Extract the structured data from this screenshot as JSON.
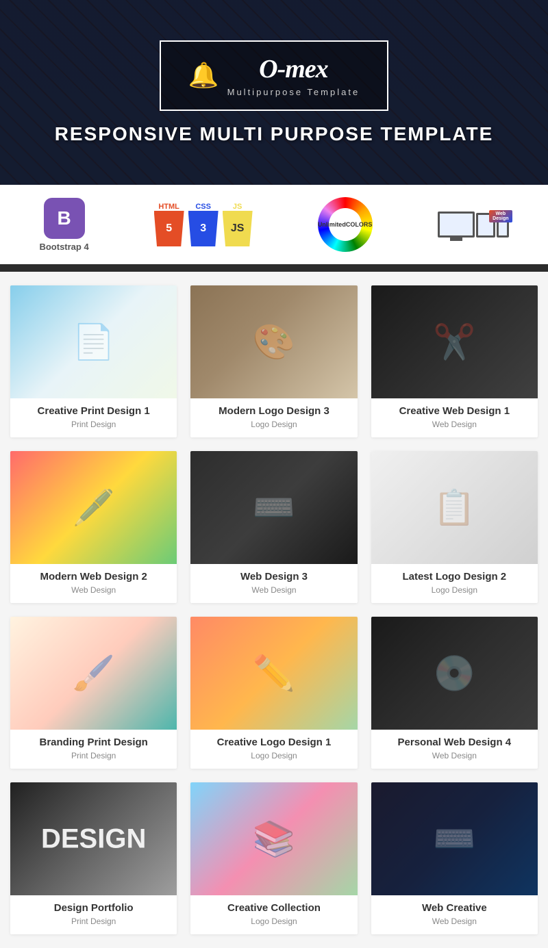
{
  "hero": {
    "logo_name": "O-mex",
    "logo_sub": "Multipurpose Template",
    "tagline": "RESPONSIVE MULTI PURPOSE TEMPLATE"
  },
  "tech_strip": {
    "bootstrap_label": "Bootstrap 4",
    "html_label": "HTML",
    "css_label": "CSS",
    "js_label": "JS",
    "colors_label": "Unlimited\nCOLORS",
    "colors_line1": "Unlimited",
    "colors_line2": "COLORS",
    "responsive_label": "Responsive Web Design",
    "ribbon_web": "Web",
    "ribbon_design": "Design"
  },
  "portfolio": {
    "items": [
      {
        "title": "Creative Print Design 1",
        "category": "Print Design",
        "img_class": "img-1"
      },
      {
        "title": "Modern Logo Design 3",
        "category": "Logo Design",
        "img_class": "img-2"
      },
      {
        "title": "Creative Web Design 1",
        "category": "Web Design",
        "img_class": "img-3"
      },
      {
        "title": "Modern Web Design 2",
        "category": "Web Design",
        "img_class": "img-4"
      },
      {
        "title": "Web Design 3",
        "category": "Web Design",
        "img_class": "img-5"
      },
      {
        "title": "Latest Logo Design 2",
        "category": "Logo Design",
        "img_class": "img-6"
      },
      {
        "title": "Branding Print Design",
        "category": "Print Design",
        "img_class": "img-7"
      },
      {
        "title": "Creative Logo Design 1",
        "category": "Logo Design",
        "img_class": "img-8"
      },
      {
        "title": "Personal Web Design 4",
        "category": "Web Design",
        "img_class": "img-9"
      },
      {
        "title": "Design Portfolio",
        "category": "Print Design",
        "img_class": "img-10"
      },
      {
        "title": "Creative Collection",
        "category": "Logo Design",
        "img_class": "img-11"
      },
      {
        "title": "Web Creative",
        "category": "Web Design",
        "img_class": "img-12"
      }
    ]
  }
}
